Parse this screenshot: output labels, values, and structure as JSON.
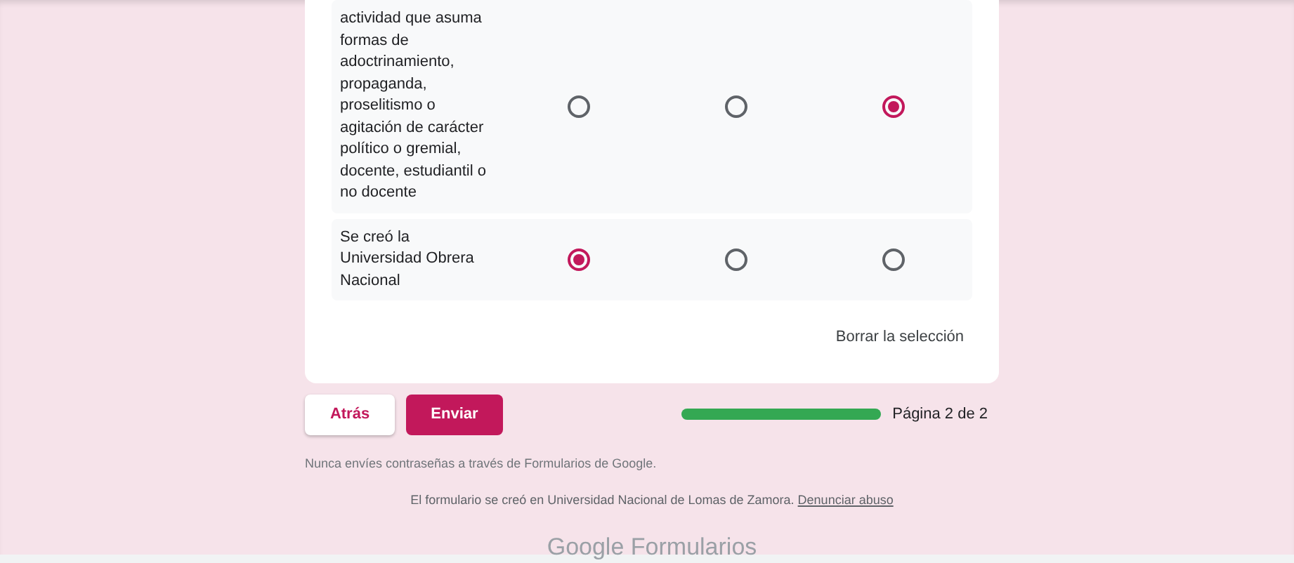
{
  "grid_question": {
    "rows": [
      {
        "label": "actividad que asuma formas de adoctrinamiento, propaganda, proselitismo o agitación de carácter político o gremial, docente, estudiantil o no docente",
        "options": [
          {
            "selected": false
          },
          {
            "selected": false
          },
          {
            "selected": true
          }
        ]
      },
      {
        "label": "Se creó la Universidad Obrera Nacional",
        "options": [
          {
            "selected": true
          },
          {
            "selected": false
          },
          {
            "selected": false
          }
        ]
      }
    ],
    "clear_label": "Borrar la selección"
  },
  "buttons": {
    "back": "Atrás",
    "submit": "Enviar"
  },
  "progress": {
    "level": 1,
    "label": "Página 2 de 2"
  },
  "notice": "Nunca envíes contraseñas a través de Formularios de Google.",
  "footer": {
    "text": "El formulario se creó en Universidad Nacional de Lomas de Zamora.",
    "link": "Denunciar abuso"
  },
  "brand": {
    "logo": "Google",
    "product": "Formularios"
  }
}
